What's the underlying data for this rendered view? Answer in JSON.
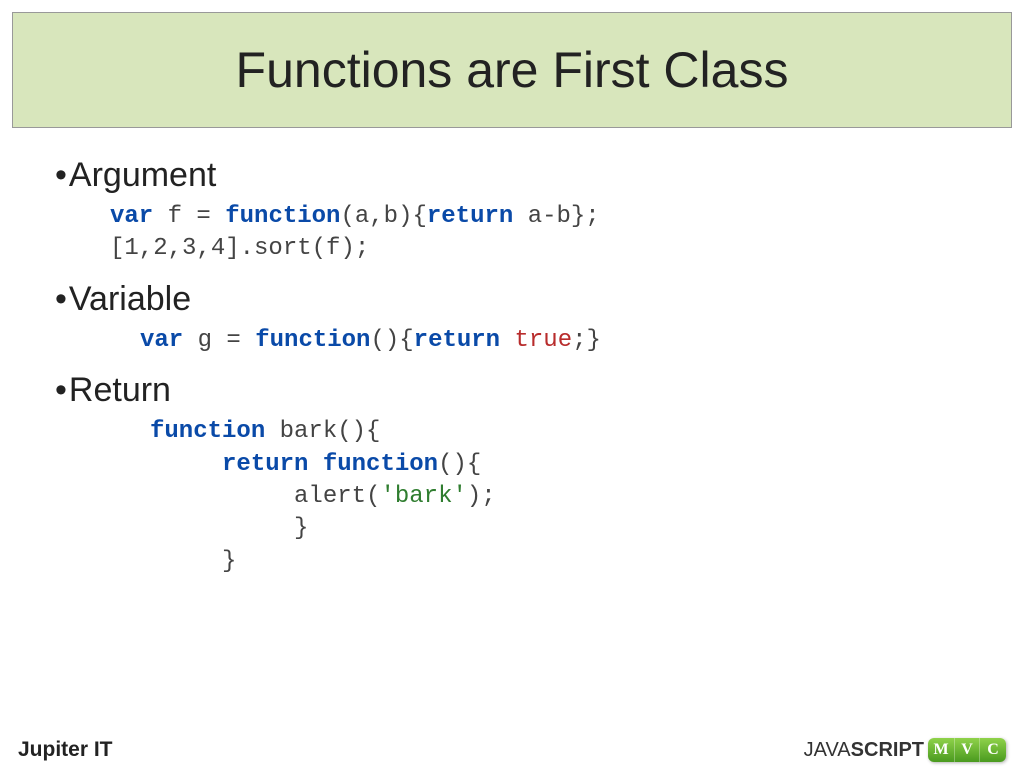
{
  "title": "Functions are First Class",
  "bullets": {
    "argument": "Argument",
    "variable": "Variable",
    "return": "Return"
  },
  "code": {
    "argument": {
      "var": "var",
      "f": " f = ",
      "function": "function",
      "params1": "(a,b){",
      "return": "return",
      "body1": " a-b};",
      "line2": "[1,2,3,4].sort(f);"
    },
    "variable": {
      "var": "var",
      "g": " g = ",
      "function": "function",
      "params": "(){",
      "return": "return",
      "sp": " ",
      "true": "true",
      "end": ";}"
    },
    "return": {
      "function1": "function",
      "bark": " bark(){",
      "return": "return",
      "sp": " ",
      "function2": "function",
      "params": "(){",
      "alert_pre": "alert(",
      "alert_str": "'bark'",
      "alert_post": ");",
      "close1": "}",
      "close2": "}"
    }
  },
  "footer": {
    "left": "Jupiter IT",
    "js_java": "JAVA",
    "js_script": "SCRIPT",
    "m": "M",
    "v": "V",
    "c": "C"
  }
}
